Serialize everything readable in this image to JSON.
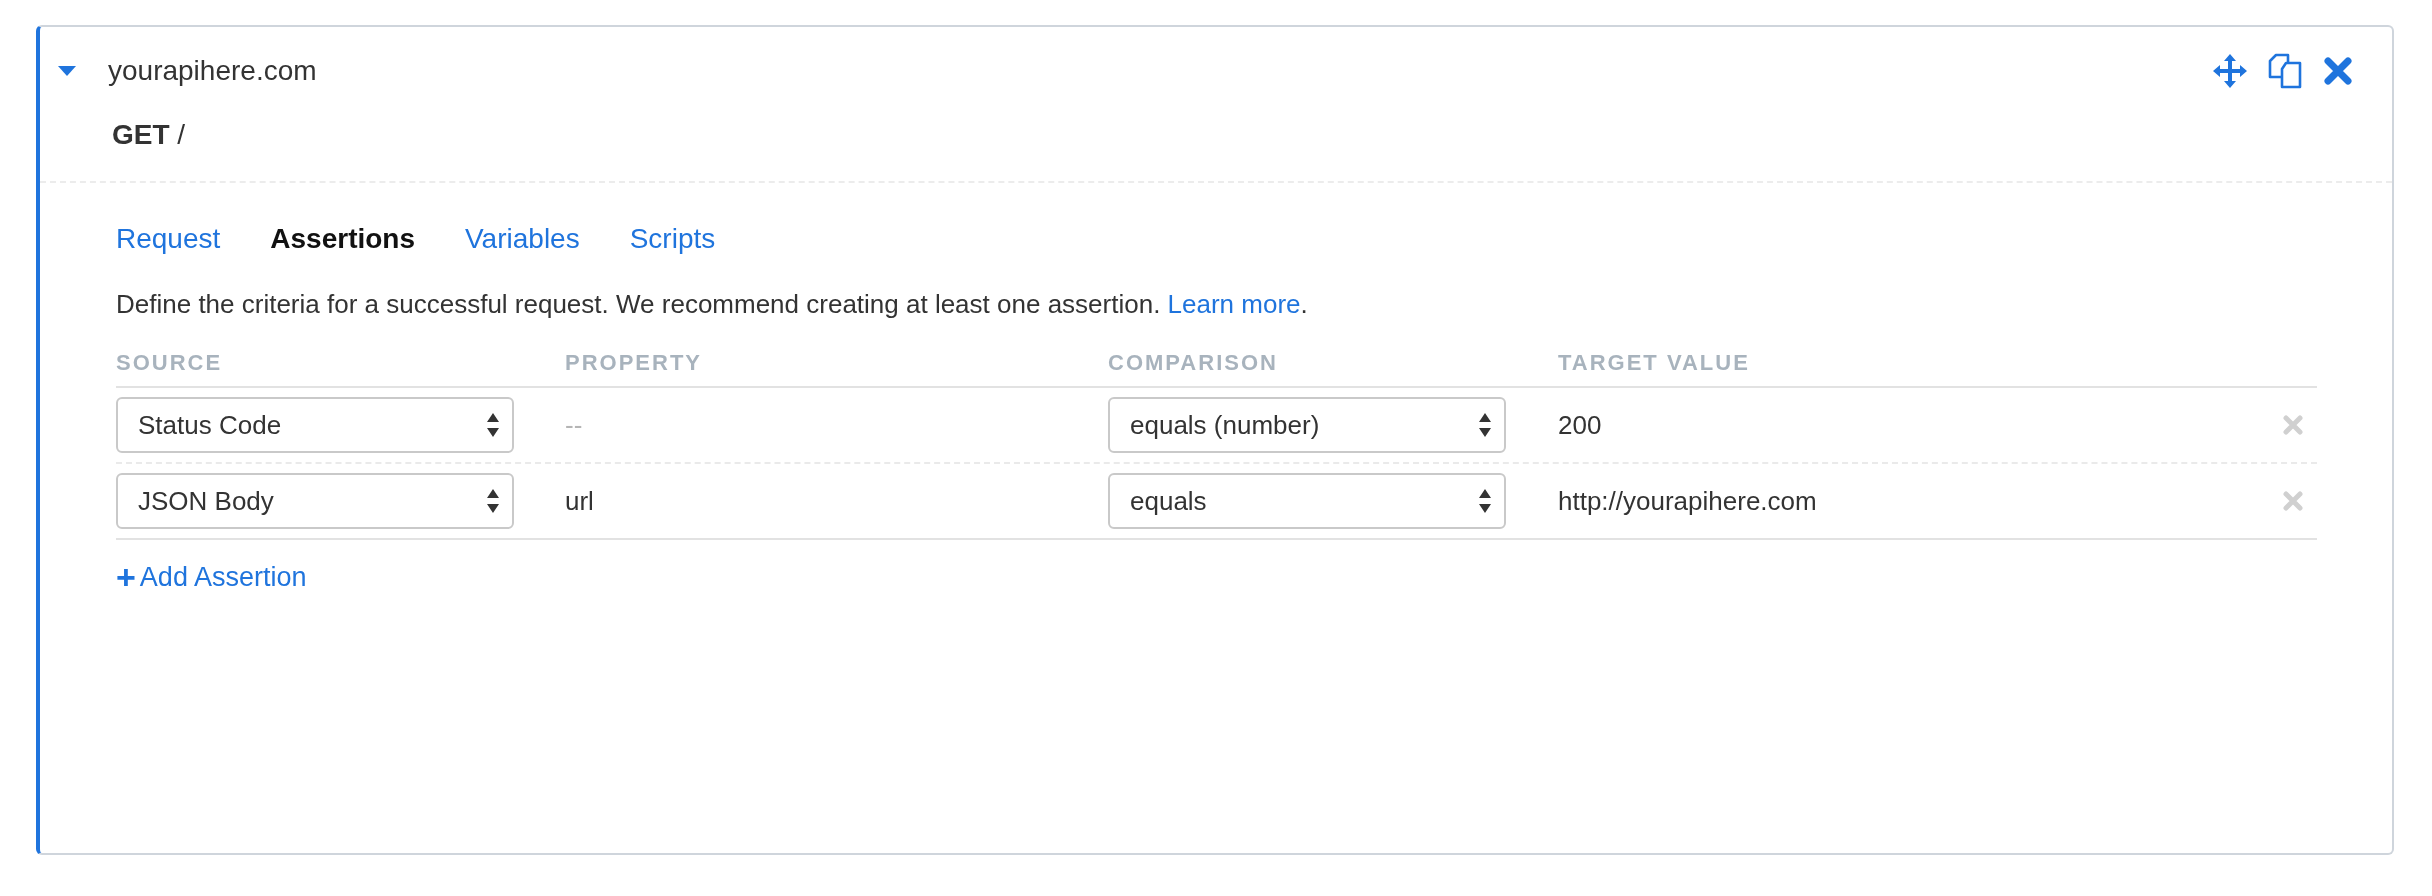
{
  "step": {
    "expanded": true,
    "host": "yourapihere.com",
    "method": "GET",
    "path": "/"
  },
  "tabs": [
    {
      "label": "Request",
      "selected": false
    },
    {
      "label": "Assertions",
      "selected": true
    },
    {
      "label": "Variables",
      "selected": false
    },
    {
      "label": "Scripts",
      "selected": false
    }
  ],
  "description": {
    "text": "Define the criteria for a successful request. We recommend creating at least one assertion. ",
    "link": "Learn more",
    "after": "."
  },
  "table": {
    "columns": [
      "SOURCE",
      "PROPERTY",
      "COMPARISON",
      "TARGET VALUE"
    ],
    "rows": [
      {
        "source": "Status Code",
        "property": {
          "placeholder": "--"
        },
        "comparison": "equals (number)",
        "target": "200"
      },
      {
        "source": "JSON Body",
        "property": {
          "value": "url"
        },
        "comparison": "equals",
        "target": "http://yourapihere.com"
      }
    ]
  },
  "add_button": {
    "icon": "+",
    "label": "Add Assertion"
  }
}
